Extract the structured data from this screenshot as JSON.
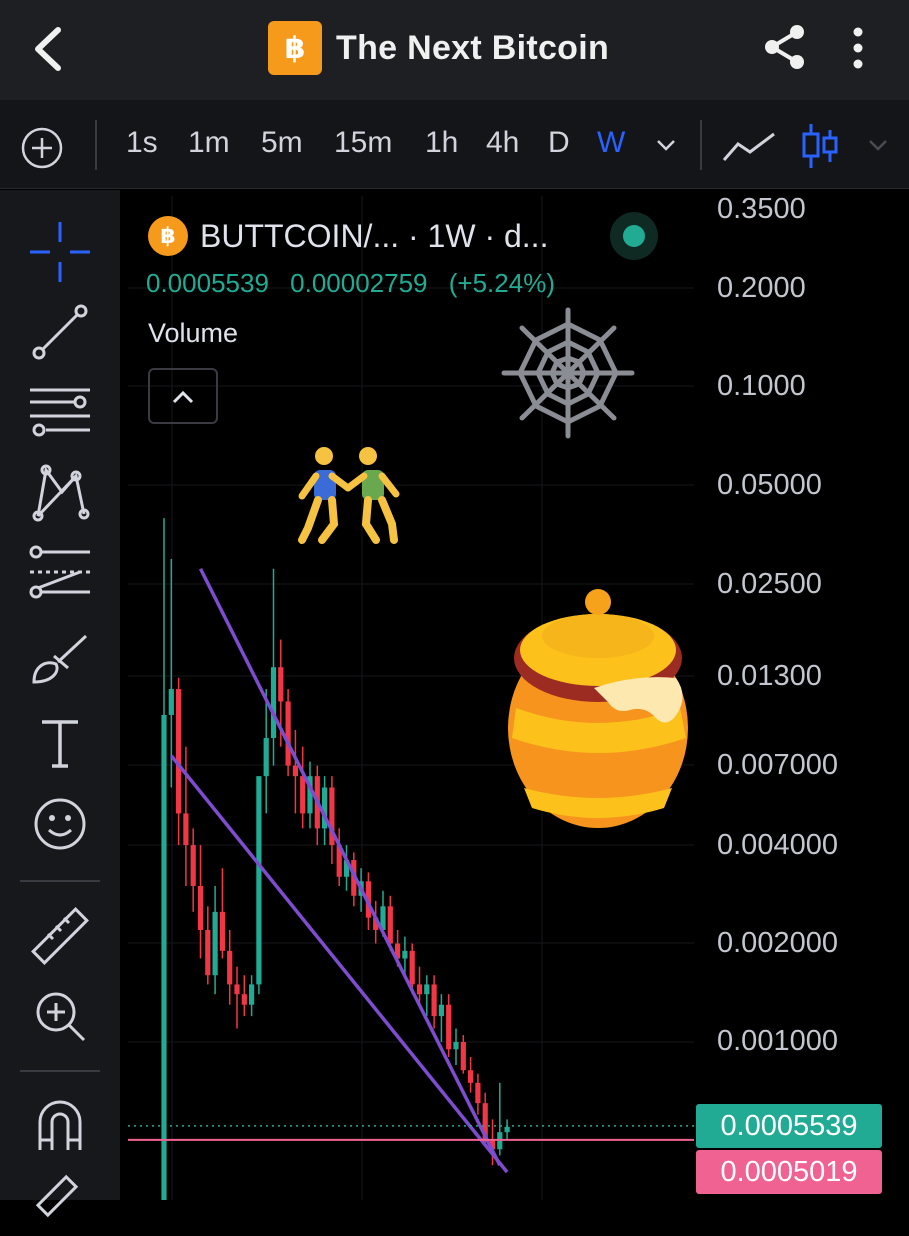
{
  "header": {
    "title": "The Next Bitcoin",
    "logo_glyph": "฿"
  },
  "toolbar": {
    "timeframes": [
      "1s",
      "1m",
      "5m",
      "15m",
      "1h",
      "4h",
      "D",
      "W"
    ],
    "active_timeframe": "W",
    "accent_color": "#2962ff"
  },
  "left_tools": [
    "crosshair-icon",
    "trend-line-icon",
    "horizontal-lines-icon",
    "pattern-icon",
    "fib-icon",
    "brush-icon",
    "text-tool-icon",
    "emoji-icon",
    "ruler-icon",
    "zoom-in-icon",
    "magnet-icon",
    "pencil-icon"
  ],
  "legend": {
    "symbol": "BUTTCOIN/... · 1W · d...",
    "coin_glyph": "฿",
    "last_price": "0.0005539",
    "change": "0.00002759",
    "change_pct": "(+5.24%)",
    "volume_label": "Volume"
  },
  "price_scale": [
    "0.3500",
    "0.2000",
    "0.1000",
    "0.05000",
    "0.02500",
    "0.01300",
    "0.007000",
    "0.004000",
    "0.002000",
    "0.001000"
  ],
  "price_tags": {
    "last": "0.0005539",
    "line": "0.0005019"
  },
  "colors": {
    "up": "#22ab94",
    "down": "#f23645",
    "trendline": "#7e4ccf",
    "horizontal_line": "#f06292"
  },
  "chart_data": {
    "type": "candlestick",
    "scale": "log",
    "y_ticks": [
      0.35,
      0.2,
      0.1,
      0.05,
      0.025,
      0.013,
      0.007,
      0.004,
      0.002,
      0.001
    ],
    "last_price": 0.0005539,
    "horizontal_line": 0.0005019,
    "candles": [
      [
        0.0003,
        0.04,
        0.0002,
        0.01
      ],
      [
        0.01,
        0.03,
        0.006,
        0.012
      ],
      [
        0.012,
        0.013,
        0.004,
        0.005
      ],
      [
        0.005,
        0.008,
        0.003,
        0.004
      ],
      [
        0.004,
        0.0045,
        0.0025,
        0.003
      ],
      [
        0.003,
        0.004,
        0.0018,
        0.0022
      ],
      [
        0.0022,
        0.0026,
        0.0015,
        0.0016
      ],
      [
        0.0016,
        0.003,
        0.0014,
        0.0025
      ],
      [
        0.0025,
        0.0034,
        0.0018,
        0.0019
      ],
      [
        0.0019,
        0.0022,
        0.0013,
        0.0015
      ],
      [
        0.0015,
        0.0017,
        0.0011,
        0.0014
      ],
      [
        0.0014,
        0.0016,
        0.0012,
        0.0013
      ],
      [
        0.0013,
        0.0016,
        0.0012,
        0.0015
      ],
      [
        0.0015,
        0.003,
        0.0014,
        0.0065
      ],
      [
        0.0065,
        0.012,
        0.005,
        0.0085
      ],
      [
        0.0085,
        0.028,
        0.007,
        0.014
      ],
      [
        0.014,
        0.017,
        0.008,
        0.011
      ],
      [
        0.011,
        0.012,
        0.0065,
        0.007
      ],
      [
        0.007,
        0.009,
        0.005,
        0.0065
      ],
      [
        0.0065,
        0.008,
        0.0045,
        0.005
      ],
      [
        0.005,
        0.0072,
        0.0045,
        0.0065
      ],
      [
        0.0065,
        0.007,
        0.004,
        0.0045
      ],
      [
        0.0045,
        0.0065,
        0.004,
        0.006
      ],
      [
        0.006,
        0.0065,
        0.0035,
        0.004
      ],
      [
        0.004,
        0.0045,
        0.003,
        0.0032
      ],
      [
        0.0032,
        0.004,
        0.0029,
        0.0036
      ],
      [
        0.0036,
        0.0038,
        0.0026,
        0.0028
      ],
      [
        0.0028,
        0.0034,
        0.0025,
        0.0031
      ],
      [
        0.0031,
        0.0033,
        0.0022,
        0.0024
      ],
      [
        0.0024,
        0.0027,
        0.002,
        0.0022
      ],
      [
        0.0022,
        0.0029,
        0.0021,
        0.0026
      ],
      [
        0.0026,
        0.0028,
        0.0019,
        0.002
      ],
      [
        0.002,
        0.0022,
        0.0017,
        0.0018
      ],
      [
        0.0018,
        0.0021,
        0.0016,
        0.0019
      ],
      [
        0.0019,
        0.002,
        0.0014,
        0.0015
      ],
      [
        0.0015,
        0.0017,
        0.0013,
        0.0014
      ],
      [
        0.0014,
        0.0016,
        0.0012,
        0.0015
      ],
      [
        0.0015,
        0.0016,
        0.0011,
        0.0012
      ],
      [
        0.0012,
        0.0014,
        0.001,
        0.0013
      ],
      [
        0.0013,
        0.0014,
        0.0009,
        0.00095
      ],
      [
        0.00095,
        0.0011,
        0.00085,
        0.001
      ],
      [
        0.001,
        0.00105,
        0.0008,
        0.00082
      ],
      [
        0.00082,
        0.0009,
        0.0007,
        0.00075
      ],
      [
        0.00075,
        0.0008,
        0.0006,
        0.00065
      ],
      [
        0.00065,
        0.0007,
        0.00048,
        0.0005
      ],
      [
        0.0005,
        0.00058,
        0.00042,
        0.00047
      ],
      [
        0.00047,
        0.00075,
        0.00045,
        0.00053
      ],
      [
        0.00053,
        0.00058,
        0.0005,
        0.00055
      ]
    ],
    "trendlines": [
      {
        "from": [
          5,
          0.028
        ],
        "to": [
          46,
          0.00042
        ]
      },
      {
        "from": [
          1,
          0.0075
        ],
        "to": [
          47,
          0.0004
        ]
      }
    ]
  }
}
